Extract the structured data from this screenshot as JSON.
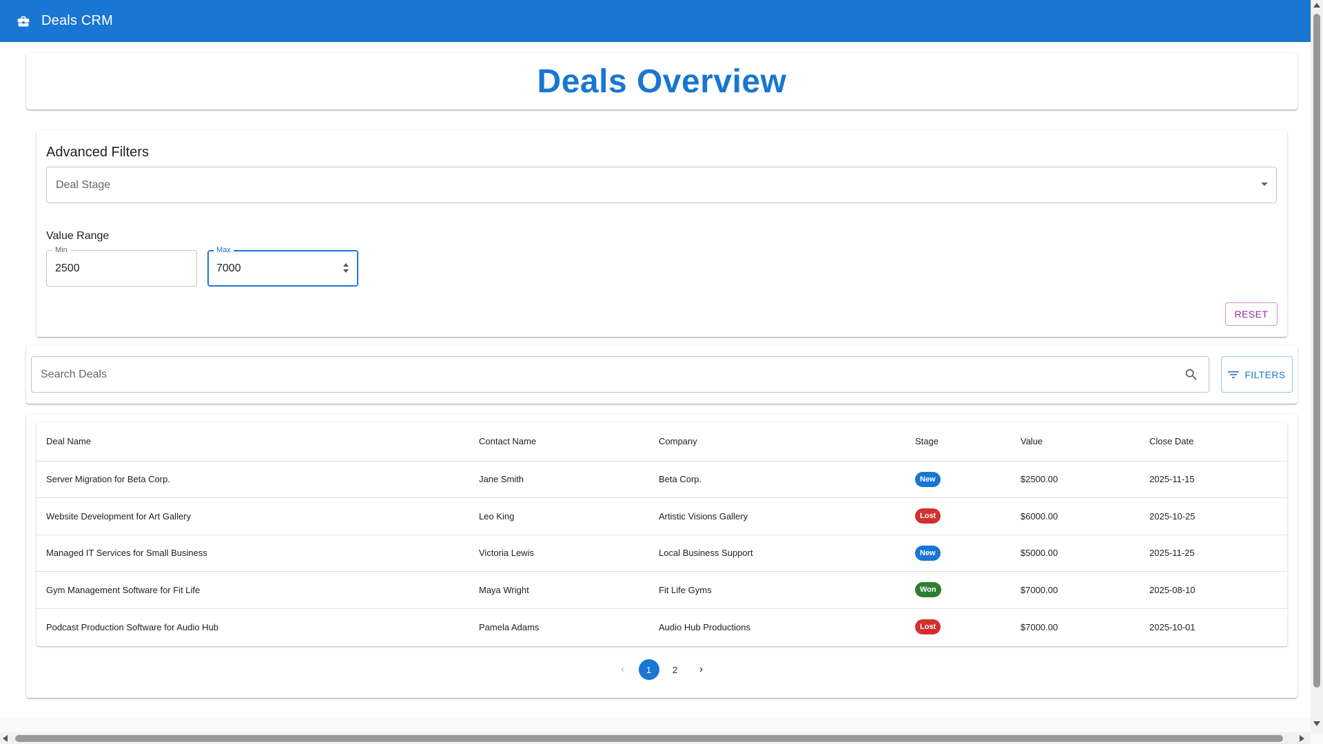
{
  "app": {
    "title": "Deals CRM",
    "icon": "briefcase-icon"
  },
  "page": {
    "title": "Deals Overview"
  },
  "filters": {
    "section_title": "Advanced Filters",
    "deal_stage_placeholder": "Deal Stage",
    "value_range_label": "Value Range",
    "min_label": "Min",
    "min_value": "2500",
    "max_label": "Max",
    "max_value": "7000",
    "reset_label": "RESET"
  },
  "search": {
    "placeholder": "Search Deals",
    "filters_button_label": "FILTERS"
  },
  "table": {
    "headers": {
      "deal_name": "Deal Name",
      "contact_name": "Contact Name",
      "company": "Company",
      "stage": "Stage",
      "value": "Value",
      "close_date": "Close Date"
    },
    "rows": [
      {
        "deal_name": "Server Migration for Beta Corp.",
        "contact_name": "Jane Smith",
        "company": "Beta Corp.",
        "stage": "New",
        "value": "$2500.00",
        "close_date": "2025-11-15"
      },
      {
        "deal_name": "Website Development for Art Gallery",
        "contact_name": "Leo King",
        "company": "Artistic Visions Gallery",
        "stage": "Lost",
        "value": "$6000.00",
        "close_date": "2025-10-25"
      },
      {
        "deal_name": "Managed IT Services for Small Business",
        "contact_name": "Victoria Lewis",
        "company": "Local Business Support",
        "stage": "New",
        "value": "$5000.00",
        "close_date": "2025-11-25"
      },
      {
        "deal_name": "Gym Management Software for Fit Life",
        "contact_name": "Maya Wright",
        "company": "Fit Life Gyms",
        "stage": "Won",
        "value": "$7000.00",
        "close_date": "2025-08-10"
      },
      {
        "deal_name": "Podcast Production Software for Audio Hub",
        "contact_name": "Pamela Adams",
        "company": "Audio Hub Productions",
        "stage": "Lost",
        "value": "$7000.00",
        "close_date": "2025-10-01"
      }
    ],
    "stage_colors": {
      "New": "#1976d2",
      "Lost": "#d32f2f",
      "Won": "#2e7d32"
    }
  },
  "pagination": {
    "pages": [
      "1",
      "2"
    ],
    "current": "1"
  },
  "colors": {
    "primary": "#1976d2",
    "secondary": "#9c27b0"
  }
}
